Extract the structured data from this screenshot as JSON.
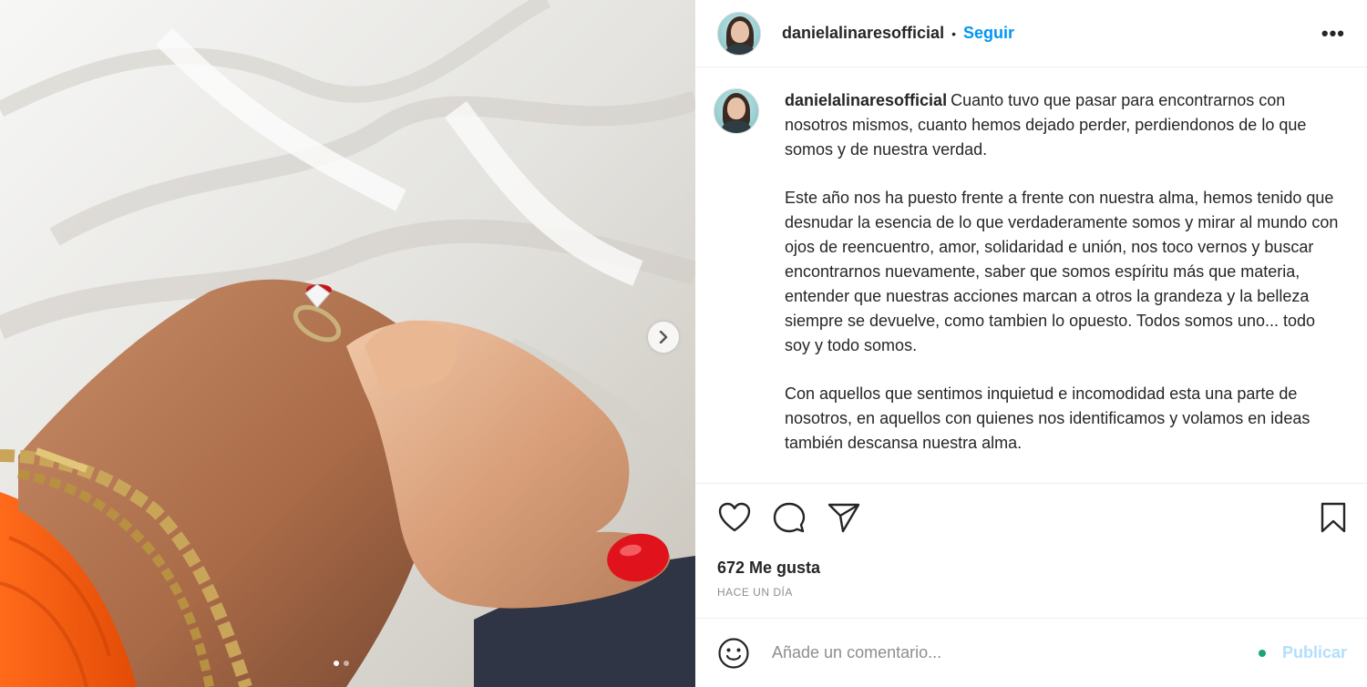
{
  "post": {
    "username": "danielalinaresofficial",
    "separator": "•",
    "follow_label": "Seguir",
    "more_label": "•••",
    "media": {
      "slide_count": 2,
      "active_slide": 1,
      "next_icon": "chevron-right-icon"
    }
  },
  "caption": {
    "username": "danielalinaresofficial",
    "paragraphs": [
      "Cuanto tuvo que pasar para encontrarnos con nosotros mismos, cuanto hemos dejado perder, perdiendonos de lo que somos y de nuestra verdad.",
      "Este año nos ha puesto frente a frente con nuestra alma, hemos tenido que desnudar la esencia de lo que verdaderamente somos y mirar al mundo con ojos de reencuentro, amor, solidaridad e unión, nos toco vernos y buscar encontrarnos nuevamente, saber que somos espíritu más que materia, entender que nuestras acciones marcan a otros la grandeza y la belleza siempre se devuelve, como tambien lo opuesto. Todos somos uno... todo soy y todo somos.",
      "Con aquellos que sentimos inquietud e incomodidad esta una parte de nosotros, en aquellos con quienes nos identificamos y volamos en ideas también descansa nuestra alma."
    ]
  },
  "actions": {
    "like_icon": "heart-icon",
    "comment_icon": "comment-bubble-icon",
    "share_icon": "paper-plane-icon",
    "save_icon": "bookmark-icon"
  },
  "likes_text": "672 Me gusta",
  "time_text": "HACE UN DÍA",
  "comment_box": {
    "placeholder": "Añade un comentario...",
    "publish_label": "Publicar",
    "emoji_icon": "emoji-icon"
  },
  "colors": {
    "accent": "#0095f6",
    "publish_disabled": "#b2dffc",
    "text": "#262626",
    "muted": "#8e8e8e",
    "border": "#efefef"
  }
}
